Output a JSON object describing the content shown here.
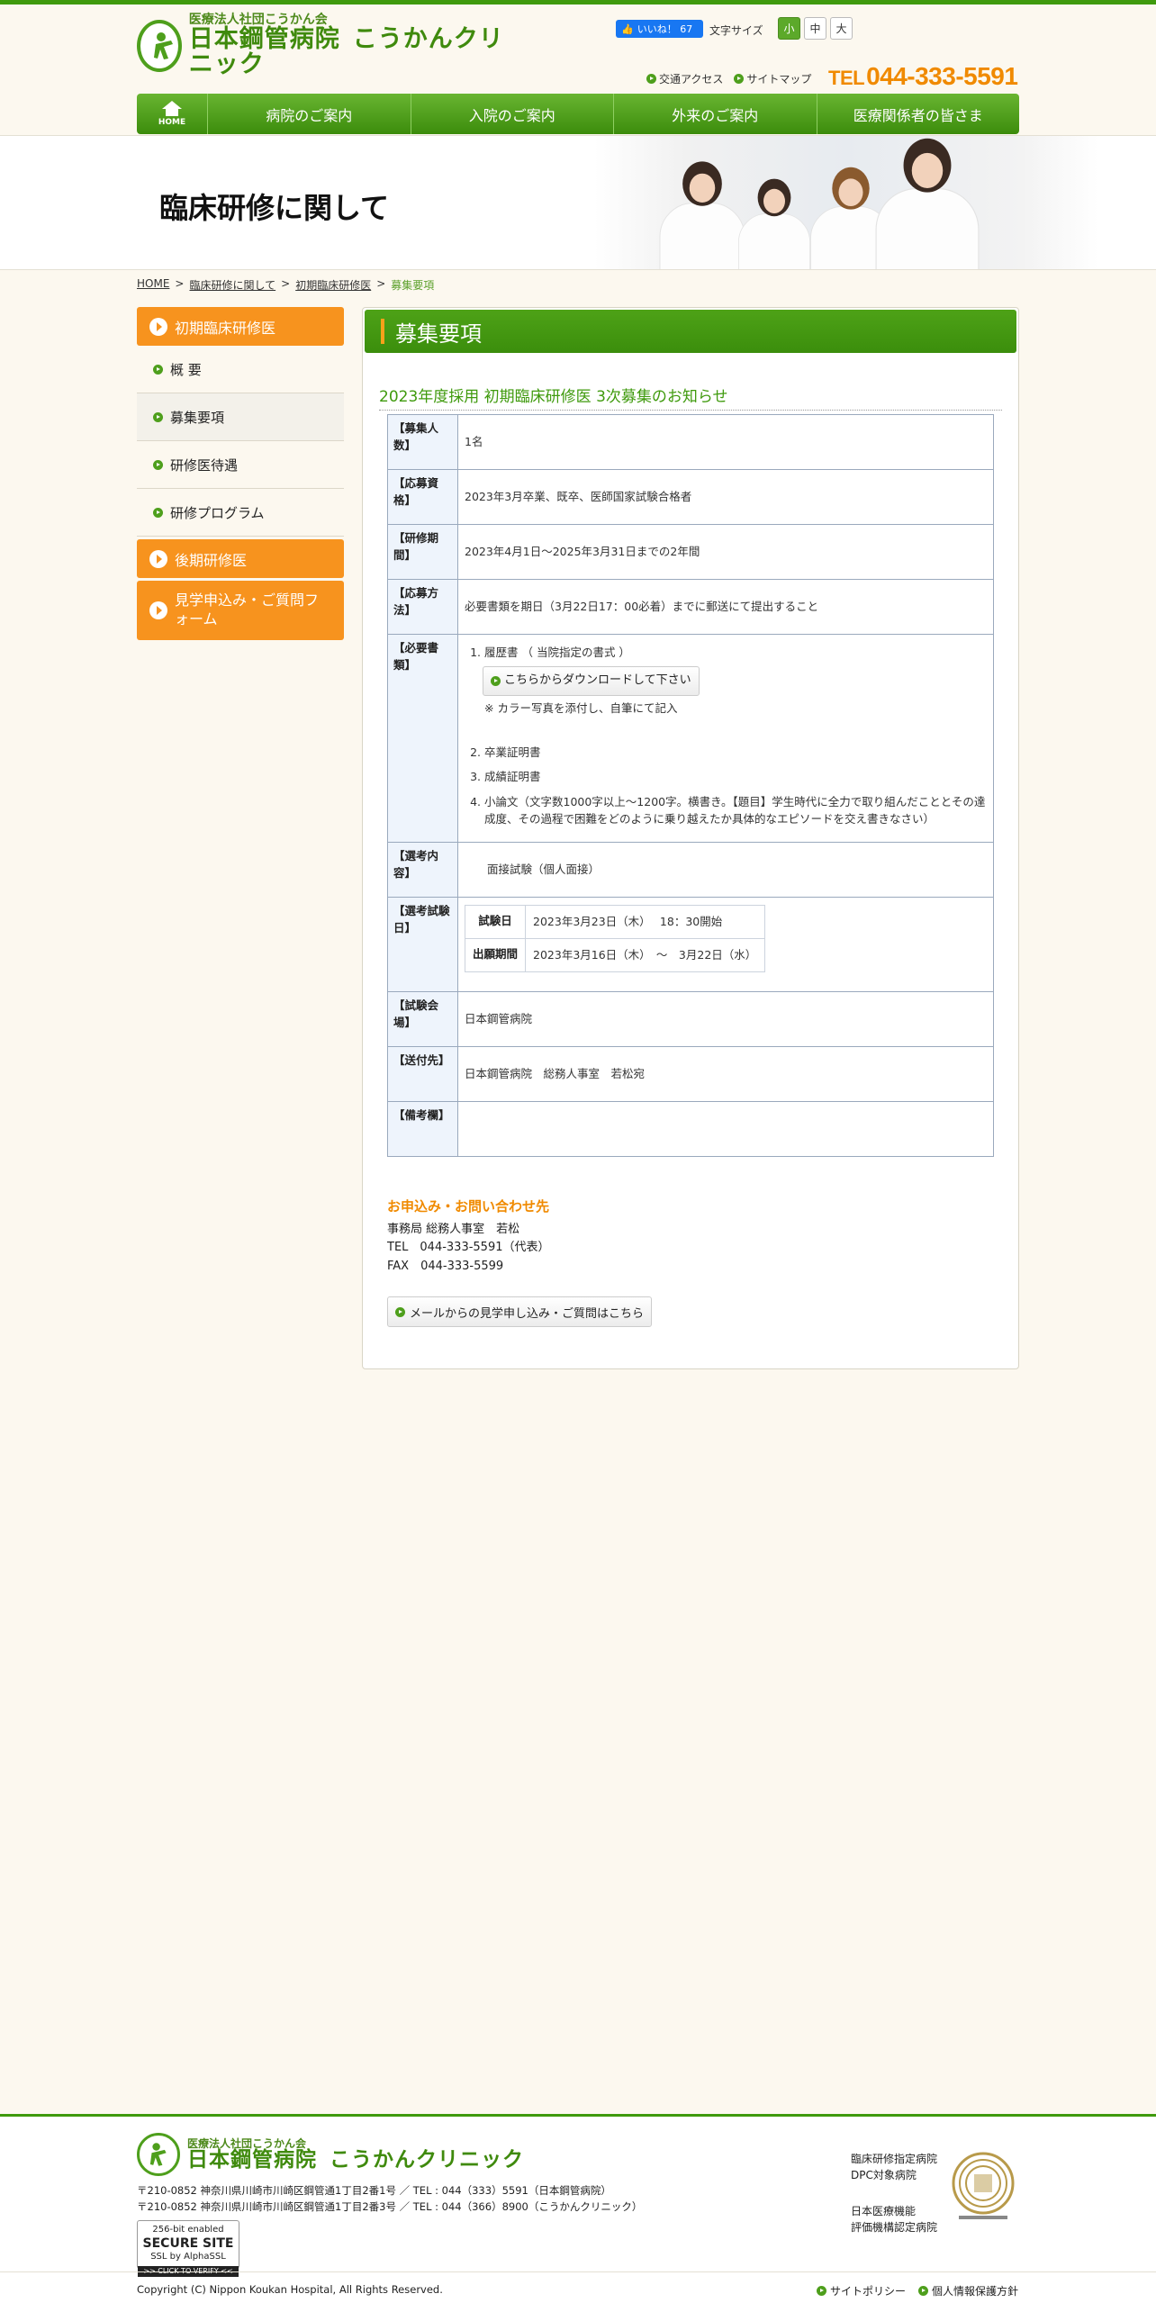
{
  "header": {
    "logo_sub": "医療法人社団こうかん会",
    "logo_main": "日本鋼管病院",
    "logo_clinic": "こうかんクリニック",
    "fb_like": "いいね！ 67",
    "fontsize_label": "文字サイズ",
    "fontsize_options": [
      "小",
      "中",
      "大"
    ],
    "util_links": [
      "交通アクセス",
      "サイトマップ"
    ],
    "tel_label": "TEL",
    "tel_number": "044-333-5591"
  },
  "nav": {
    "home_label": "HOME",
    "items": [
      "病院のご案内",
      "入院のご案内",
      "外来のご案内",
      "医療関係者の皆さま"
    ]
  },
  "banner": {
    "title": "臨床研修に関して"
  },
  "breadcrumb": [
    "HOME",
    "臨床研修に関して",
    "初期臨床研修医",
    "募集要項"
  ],
  "sidebar": {
    "section1": "初期臨床研修医",
    "sub_items": [
      "概 要",
      "募集要項",
      "研修医待遇",
      "研修プログラム"
    ],
    "section2": "後期研修医",
    "section3": "見学申込み・ご質問フォーム"
  },
  "main": {
    "heading": "募集要項",
    "subtitle": "2023年度採用 初期臨床研修医 3次募集のお知らせ",
    "rows": {
      "count_label": "【募集人数】",
      "count_value": "1名",
      "qual_label": "【応募資格】",
      "qual_value": "2023年3月卒業、既卒、医師国家試験合格者",
      "period_label": "【研修期間】",
      "period_value": "2023年4月1日～2025年3月31日までの2年間",
      "method_label": "【応募方法】",
      "method_value": "必要書類を期日（3月22日17：00必着）までに郵送にて提出すること",
      "docs_label": "【必要書類】",
      "docs": [
        "履歴書 （ 当院指定の書式 ）",
        "卒業証明書",
        "成績証明書",
        "小論文（文字数1000字以上～1200字。横書き。【題目】学生時代に全力で取り組んだこととその達成度、その過程で困難をどのように乗り越えたか具体的なエピソードを交え書きなさい）"
      ],
      "download_label": "こちらからダウンロードして下さい",
      "docs_note": "※ カラー写真を添付し、自筆にて記入",
      "selection_label": "【選考内容】",
      "selection_value": "面接試験（個人面接）",
      "exam_label": "【選考試験日】",
      "exam_date_label": "試験日",
      "exam_date_value": "2023年3月23日（木）　 18：30開始",
      "apply_period_label": "出願期間",
      "apply_period_value": "2023年3月16日（木）　～　3月22日（水）",
      "venue_label": "【試験会場】",
      "venue_value": "日本鋼管病院",
      "send_label": "【送付先】",
      "send_value": "日本鋼管病院　総務人事室　若松宛",
      "remarks_label": "【備考欄】",
      "remarks_value": ""
    },
    "contact": {
      "title": "お申込み・お問い合わせ先",
      "office": "事務局 総務人事室　若松",
      "tel": "TEL　044-333-5591（代表）",
      "fax": "FAX　044-333-5599"
    },
    "mail_button": "メールからの見学申し込み・ご質問はこちら"
  },
  "footer": {
    "logo_sub": "医療法人社団こうかん会",
    "logo_main": "日本鋼管病院",
    "logo_clinic": "こうかんクリニック",
    "address1": "〒210-0852 神奈川県川崎市川崎区鋼管通1丁目2番1号 ／ TEL : 044（333）5591（日本鋼管病院）",
    "address2": "〒210-0852 神奈川県川崎市川崎区鋼管通1丁目2番3号 ／ TEL : 044（366）8900（こうかんクリニック）",
    "ssl_line1": "256-bit enabled",
    "ssl_line2": "SECURE SITE",
    "ssl_line3": "SSL by AlphaSSL",
    "ssl_verify": ">> CLICK TO VERIFY <<",
    "cert1_line1": "臨床研修指定病院",
    "cert1_line2": "DPC対象病院",
    "cert2_line1": "日本医療機能",
    "cert2_line2": "評価機構認定病院",
    "copyright": "Copyright (C) Nippon Koukan Hospital, All Rights Reserved.",
    "links": [
      "サイトポリシー",
      "個人情報保護方針"
    ]
  },
  "colors": {
    "brand_green": "#3f9a0d",
    "accent_orange": "#f7931e",
    "table_header": "#eef4fc"
  }
}
